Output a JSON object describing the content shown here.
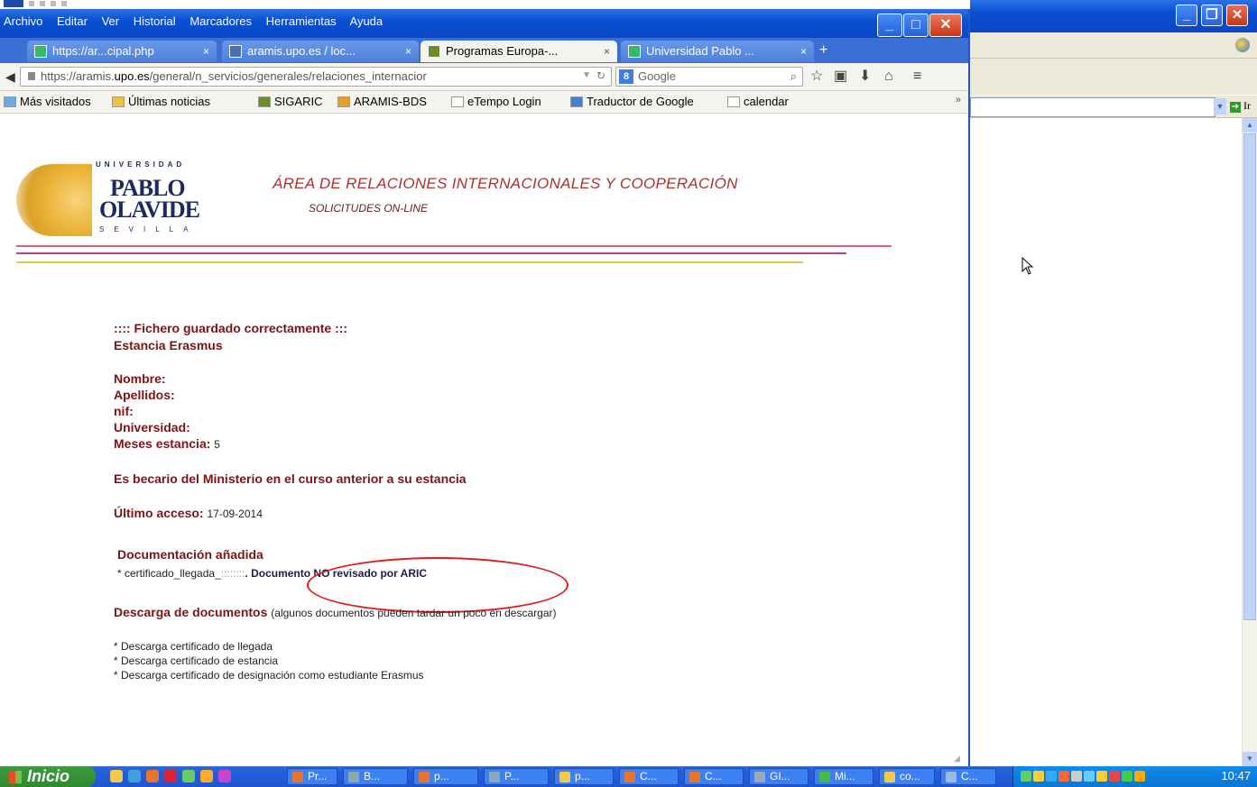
{
  "browser": {
    "menu": [
      "Archivo",
      "Editar",
      "Ver",
      "Historial",
      "Marcadores",
      "Herramientas",
      "Ayuda"
    ],
    "tabs": [
      {
        "label": "https://ar...cipal.php"
      },
      {
        "label": "aramis.upo.es / loc..."
      },
      {
        "label": "Programas Europa-..."
      },
      {
        "label": "Universidad Pablo ..."
      }
    ],
    "tab_close": "×",
    "new_tab": "+",
    "url_prefix": "https://aramis.",
    "url_domain": "upo.es",
    "url_suffix": "/general/n_servicios/generales/relaciones_internacior",
    "search_placeholder": "Google",
    "bookmarks": [
      "Más visitados",
      "Últimas noticias",
      "SIGARIC",
      "ARAMIS-BDS",
      "eTempo Login",
      "Traductor de Google",
      "calendar"
    ],
    "bookmarks_more": "»"
  },
  "header": {
    "logo": {
      "top": "UNIVERSIDAD",
      "line1": "PABLO",
      "line2": "OLAVIDE",
      "bottom": "SEVILLA"
    },
    "title": "ÁREA DE RELACIONES INTERNACIONALES Y COOPERACIÓN",
    "subtitle": "SOLICITUDES ON-LINE"
  },
  "main": {
    "status": ":::: Fichero guardado correctamente :::",
    "program": "Estancia Erasmus",
    "fields": {
      "nombre_label": "Nombre:",
      "apellidos_label": "Apellidos:",
      "nif_label": "nif:",
      "universidad_label": "Universidad:",
      "meses_label": "Meses estancia:",
      "meses_value": "5"
    },
    "becario_text": "Es becario del Ministerio en el curso anterior a su estancia",
    "ultimo_acceso_label": "Último acceso:",
    "ultimo_acceso_value": "17-09-2014",
    "doc_heading": "Documentación añadida",
    "doc_item_prefix": "* certificado_llegada_",
    "doc_item_masked": "::::::::",
    "doc_item_status": ". Documento NO revisado por ARIC",
    "descarga_heading": "Descarga de documentos",
    "descarga_note": "(algunos documentos pueden tardar un poco en descargar)",
    "downloads": [
      "* Descarga certificado de llegada",
      "* Descarga certificado de estancia",
      "* Descarga certificado de designación como estudiante Erasmus"
    ]
  },
  "background_window": {
    "go_label": "Ir"
  },
  "taskbar": {
    "start_label": "Inicio",
    "tasks": [
      "Pr...",
      "B...",
      "p...",
      "P...",
      "p...",
      "C...",
      "C...",
      "GI...",
      "Mi...",
      "co...",
      "C..."
    ],
    "clock": "10:47"
  },
  "colors": {
    "accent_dark_red": "#7c1416",
    "title_red": "#b0302d",
    "annotation_circle": "#e01a1a",
    "xp_blue": "#245edb"
  }
}
